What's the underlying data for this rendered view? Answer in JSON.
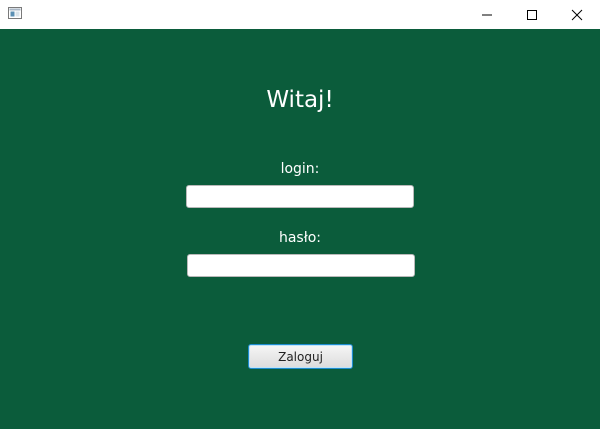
{
  "window": {
    "icon": "java-app-icon",
    "controls": {
      "minimize_icon": "minimize-icon",
      "maximize_icon": "maximize-icon",
      "close_icon": "close-icon"
    }
  },
  "form": {
    "heading": "Witaj!",
    "login_label": "login:",
    "login_value": "",
    "password_label": "hasło:",
    "password_value": "",
    "submit_label": "Zaloguj"
  },
  "colors": {
    "background": "#0b5c3b",
    "text": "#ffffff",
    "button_focus_border": "#1e8ccf"
  }
}
